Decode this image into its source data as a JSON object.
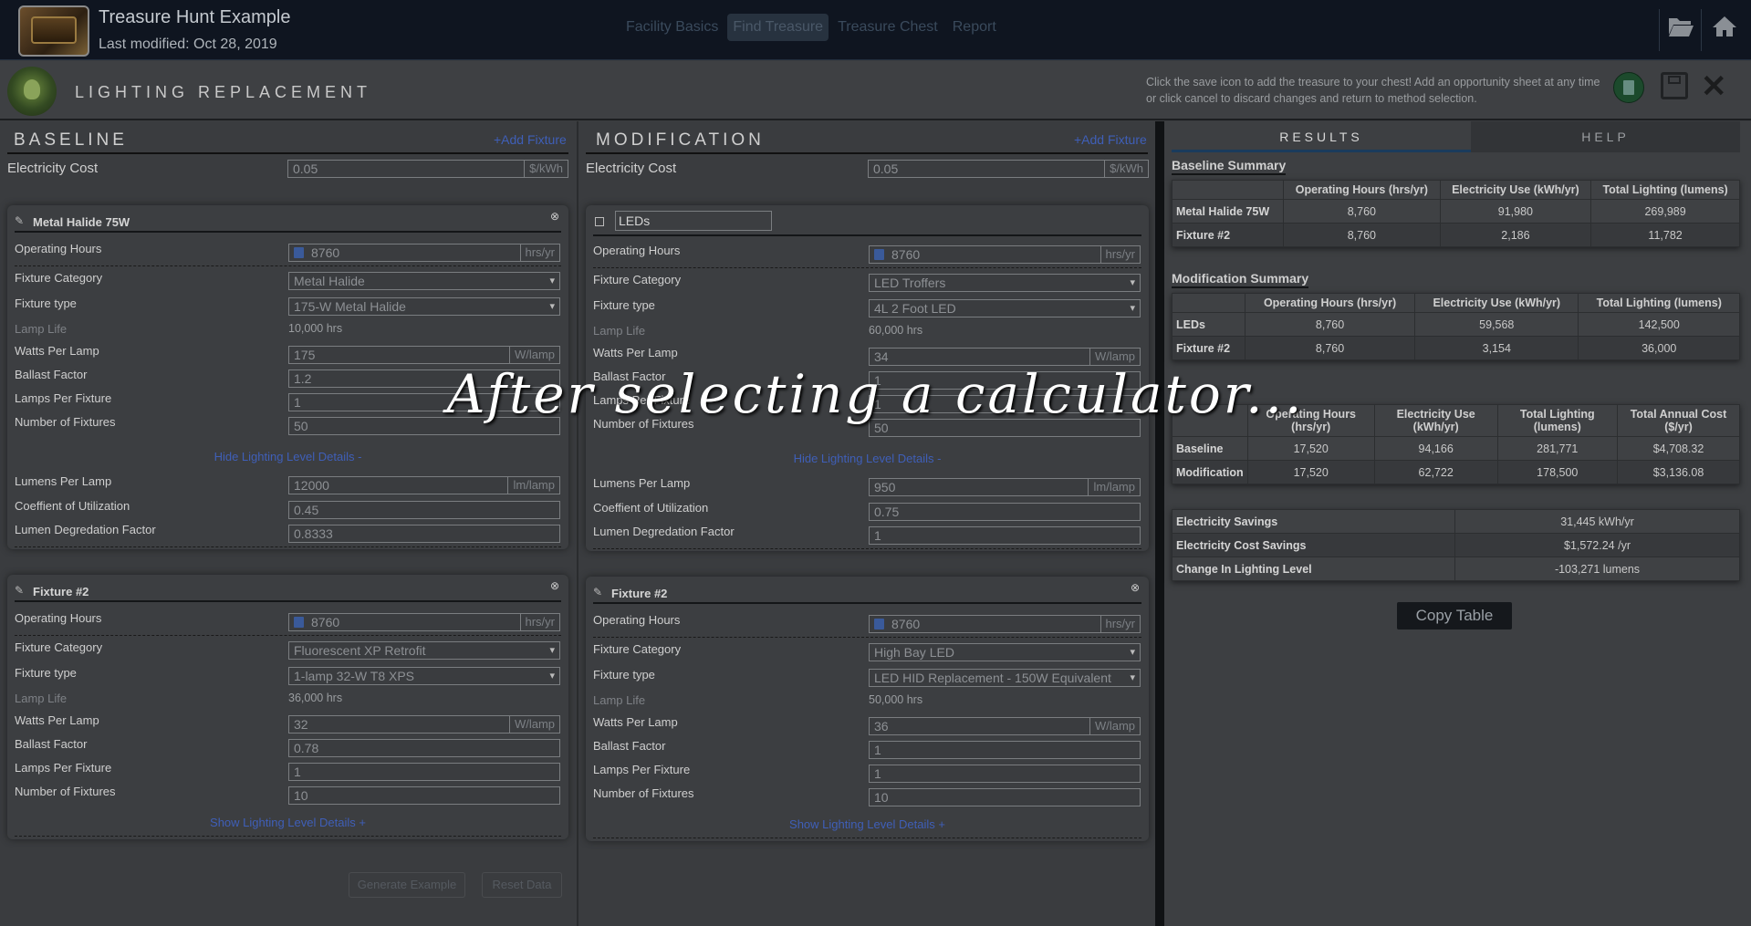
{
  "app": {
    "title": "Treasure Hunt Example",
    "last_modified": "Last modified: Oct 28, 2019",
    "nav_tabs": [
      "Facility Basics",
      "Find Treasure",
      "Treasure Chest",
      "Report"
    ],
    "active_tab": "Find Treasure"
  },
  "calculator": {
    "title": "LIGHTING REPLACEMENT",
    "help_text": "Click the save icon to add the treasure to your chest! Add an opportunity sheet at any time or click cancel to discard changes and return to method selection."
  },
  "baseline": {
    "title": "BASELINE",
    "add_fixture": "+Add Fixture",
    "electricity_cost_label": "Electricity Cost",
    "electricity_cost": "0.05",
    "electricity_cost_unit": "$/kWh",
    "fixtures": [
      {
        "name": "Metal Halide 75W",
        "operating_hours": "8760",
        "operating_hours_unit": "hrs/yr",
        "fixture_category": "Metal Halide",
        "fixture_type": "175-W Metal Halide",
        "lamp_life": "10,000 hrs",
        "watts_per_lamp": "175",
        "watts_unit": "W/lamp",
        "ballast_factor": "1.2",
        "lamps_per_fixture": "1",
        "number_of_fixtures": "50",
        "toggle_link": "Hide Lighting Level Details -",
        "lumens_per_lamp": "12000",
        "lumens_unit": "lm/lamp",
        "coefficient_of_utilization": "0.45",
        "lumen_degredation_factor": "0.8333"
      },
      {
        "name": "Fixture #2",
        "operating_hours": "8760",
        "operating_hours_unit": "hrs/yr",
        "fixture_category": "Fluorescent XP Retrofit",
        "fixture_type": "1-lamp 32-W T8 XPS",
        "lamp_life": "36,000 hrs",
        "watts_per_lamp": "32",
        "watts_unit": "W/lamp",
        "ballast_factor": "0.78",
        "lamps_per_fixture": "1",
        "number_of_fixtures": "10",
        "toggle_link": "Show Lighting Level Details +"
      }
    ],
    "generate_example": "Generate Example",
    "reset_data": "Reset Data"
  },
  "modification": {
    "title": "MODIFICATION",
    "add_fixture": "+Add Fixture",
    "electricity_cost_label": "Electricity Cost",
    "electricity_cost": "0.05",
    "electricity_cost_unit": "$/kWh",
    "fixtures": [
      {
        "name": "LEDs",
        "operating_hours": "8760",
        "operating_hours_unit": "hrs/yr",
        "fixture_category": "LED Troffers",
        "fixture_type": "4L 2 Foot LED",
        "lamp_life": "60,000 hrs",
        "watts_per_lamp": "34",
        "watts_unit": "W/lamp",
        "ballast_factor": "1",
        "lamps_per_fixture": "1",
        "number_of_fixtures": "50",
        "toggle_link": "Hide Lighting Level Details -",
        "lumens_per_lamp": "950",
        "lumens_unit": "lm/lamp",
        "coefficient_of_utilization": "0.75",
        "lumen_degredation_factor": "1"
      },
      {
        "name": "Fixture #2",
        "operating_hours": "8760",
        "operating_hours_unit": "hrs/yr",
        "fixture_category": "High Bay LED",
        "fixture_type": "LED HID Replacement - 150W Equivalent",
        "lamp_life": "50,000 hrs",
        "watts_per_lamp": "36",
        "watts_unit": "W/lamp",
        "ballast_factor": "1",
        "lamps_per_fixture": "1",
        "number_of_fixtures": "10",
        "toggle_link": "Show Lighting Level Details +"
      }
    ]
  },
  "labels": {
    "operating_hours": "Operating Hours",
    "fixture_category": "Fixture Category",
    "fixture_type": "Fixture type",
    "lamp_life": "Lamp Life",
    "watts_per_lamp": "Watts Per Lamp",
    "ballast_factor": "Ballast Factor",
    "lamps_per_fixture": "Lamps Per Fixture",
    "number_of_fixtures": "Number of Fixtures",
    "lumens_per_lamp": "Lumens Per Lamp",
    "coefficient_of_utilization": "Coeffient of Utilization",
    "lumen_degredation_factor": "Lumen Degredation Factor"
  },
  "results": {
    "tab_results": "RESULTS",
    "tab_help": "HELP",
    "baseline_summary_title": "Baseline Summary",
    "modification_summary_title": "Modification Summary",
    "summary_headers": [
      "Operating Hours (hrs/yr)",
      "Electricity Use (kWh/yr)",
      "Total Lighting (lumens)"
    ],
    "baseline_rows": [
      [
        "Metal Halide 75W",
        "8,760",
        "91,980",
        "269,989"
      ],
      [
        "Fixture #2",
        "8,760",
        "2,186",
        "11,782"
      ]
    ],
    "modification_rows": [
      [
        "LEDs",
        "8,760",
        "59,568",
        "142,500"
      ],
      [
        "Fixture #2",
        "8,760",
        "3,154",
        "36,000"
      ]
    ],
    "totals_headers": [
      "Operating Hours (hrs/yr)",
      "Electricity Use (kWh/yr)",
      "Total Lighting (lumens)",
      "Total Annual Cost ($/yr)"
    ],
    "totals_rows": [
      [
        "Baseline",
        "17,520",
        "94,166",
        "281,771",
        "$4,708.32"
      ],
      [
        "Modification",
        "17,520",
        "62,722",
        "178,500",
        "$3,136.08"
      ]
    ],
    "savings_rows": [
      [
        "Electricity Savings",
        "31,445 kWh/yr"
      ],
      [
        "Electricity Cost Savings",
        "$1,572.24 /yr"
      ],
      [
        "Change In Lighting Level",
        "-103,271 lumens"
      ]
    ],
    "copy_table": "Copy Table"
  },
  "caption": "After selecting a calculator..."
}
